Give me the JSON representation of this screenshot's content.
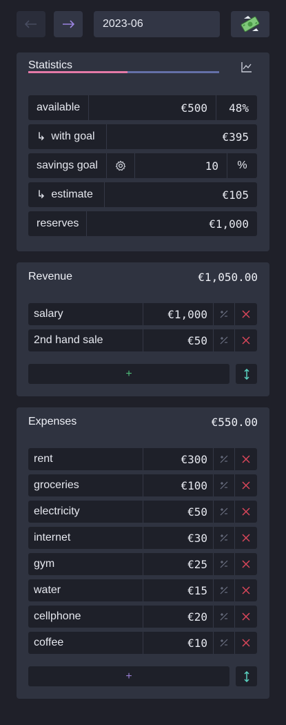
{
  "header": {
    "month": "2023-06",
    "prev_icon": "arrow-left-icon",
    "next_icon": "arrow-right-icon",
    "money_icon": "flying-money-icon"
  },
  "statistics": {
    "title": "Statistics",
    "rows": {
      "available": {
        "label": "available",
        "value": "€500",
        "percent": "48%"
      },
      "with_goal": {
        "arrow": "↳",
        "label": "with goal",
        "value": "€395"
      },
      "savings_goal": {
        "label": "savings goal",
        "value": "10",
        "unit": "%"
      },
      "estimate": {
        "arrow": "↳",
        "label": "estimate",
        "value": "€105"
      },
      "reserves": {
        "label": "reserves",
        "value": "€1,000"
      }
    }
  },
  "revenue": {
    "title": "Revenue",
    "total": "€1,050.00",
    "add_label": "+",
    "items": [
      {
        "name": "salary",
        "amount": "€1,000"
      },
      {
        "name": "2nd hand sale",
        "amount": "€50"
      }
    ]
  },
  "expenses": {
    "title": "Expenses",
    "total": "€550.00",
    "add_label": "+",
    "items": [
      {
        "name": "rent",
        "amount": "€300"
      },
      {
        "name": "groceries",
        "amount": "€100"
      },
      {
        "name": "electricity",
        "amount": "€50"
      },
      {
        "name": "internet",
        "amount": "€30"
      },
      {
        "name": "gym",
        "amount": "€25"
      },
      {
        "name": "water",
        "amount": "€15"
      },
      {
        "name": "cellphone",
        "amount": "€20"
      },
      {
        "name": "coffee",
        "amount": "€10"
      }
    ]
  },
  "colors": {
    "background": "#1f2029",
    "panel": "#2f3340",
    "accent_pink": "#e57aa8",
    "accent_blue": "#6470a8",
    "delete_red": "#d9465a",
    "add_green": "#4fbf7a",
    "add_purple": "#9a7fd6",
    "sort_teal": "#5ad1c0"
  }
}
